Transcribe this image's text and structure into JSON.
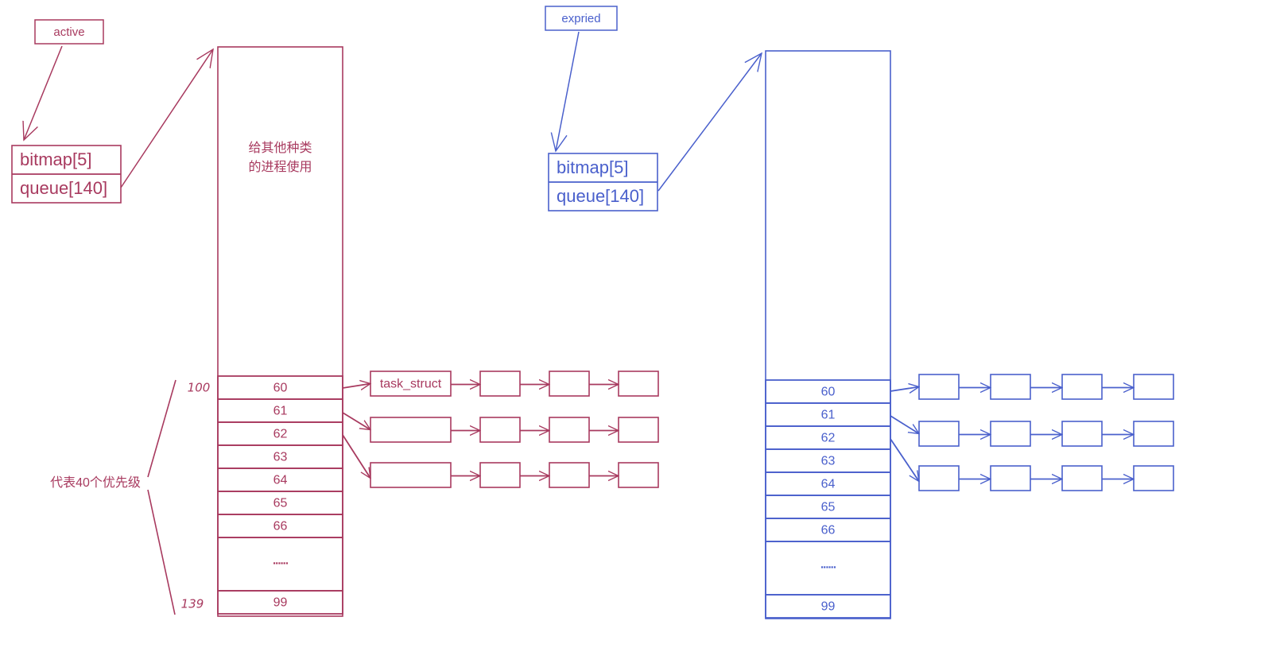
{
  "colors": {
    "active": "#a83a5f",
    "expired": "#4a60cc",
    "background": "#ffffff"
  },
  "panels": [
    {
      "key": "active",
      "label": "active",
      "struct_fields": [
        "bitmap[5]",
        "queue[140]"
      ],
      "big_box_note_lines": [
        "给其他种类",
        "的进程使用"
      ],
      "slots": [
        "60",
        "61",
        "62",
        "63",
        "64",
        "65",
        "66",
        "......",
        "99"
      ],
      "range_start_label": "100",
      "range_end_label": "139",
      "range_caption": "代表40个优先级",
      "chains": [
        {
          "from_slot": "60",
          "nodes": [
            "task_struct",
            "",
            "",
            ""
          ]
        },
        {
          "from_slot": "61",
          "nodes": [
            "",
            "",
            "",
            ""
          ]
        },
        {
          "from_slot": "62",
          "nodes": [
            "",
            "",
            "",
            ""
          ]
        }
      ]
    },
    {
      "key": "expired",
      "label": "expried",
      "struct_fields": [
        "bitmap[5]",
        "queue[140]"
      ],
      "big_box_note_lines": [],
      "slots": [
        "60",
        "61",
        "62",
        "63",
        "64",
        "65",
        "66",
        "......",
        "99"
      ],
      "range_start_label": "",
      "range_end_label": "",
      "range_caption": "",
      "chains": [
        {
          "from_slot": "60",
          "nodes": [
            "",
            "",
            "",
            ""
          ]
        },
        {
          "from_slot": "61",
          "nodes": [
            "",
            "",
            "",
            ""
          ]
        },
        {
          "from_slot": "62",
          "nodes": [
            "",
            "",
            "",
            ""
          ]
        }
      ]
    }
  ]
}
